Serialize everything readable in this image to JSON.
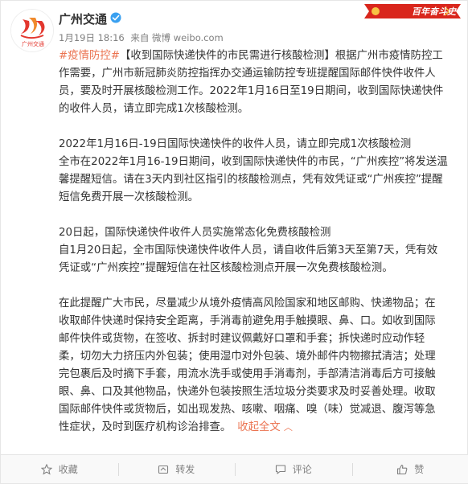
{
  "header": {
    "user_name": "广州交通",
    "time": "1月19日 18:16",
    "source": "来自 微博 weibo.com",
    "banner_text": "百年奋斗史"
  },
  "post": {
    "intro_hashtag": "#疫情防控#",
    "intro_lines": [
      "【收到国际快递快件的市民需进行核酸检测】根据广州市疫情防控工",
      "作需要，广州市新冠肺炎防控指挥办交通运输防控专班提醒国际邮件快件收件人",
      "员，要及时开展核酸检测工作。2022年1月16日至19日期间，收到国际快递快件",
      "的收件人员，请立即完成1次核酸检测。"
    ],
    "section1": [
      "2022年1月16日-19日国际快递快件的收件人员，请立即完成1次核酸检测",
      "全市在2022年1月16-19日期间，收到国际快递快件的市民，“广州疾控”将发送温",
      "馨提醒短信。请在3天内到社区指引的核酸检测点，凭有效凭证或“广州疾控”提醒",
      "短信免费开展一次核酸检测。"
    ],
    "section2": [
      "20日起，国际快递快件收件人员实施常态化免费核酸检测",
      "自1月20日起，全市国际快递快件收件人员，请自收件后第3天至第7天，凭有效",
      "凭证或“广州疾控”提醒短信在社区核酸检测点开展一次免费核酸检测。"
    ],
    "section3": [
      "在此提醒广大市民，尽量减少从境外疫情高风险国家和地区邮购、快递物品；在",
      "收取邮件快递时保持安全距离，手消毒前避免用手触摸眼、鼻、口。如收到国际",
      "邮件快件或货物，在签收、拆封时建议佩戴好口罩和手套；拆快递时应动作轻",
      "柔，切勿大力挤压内外包装；使用湿巾对外包装、境外邮件内物擦拭清洁；处理",
      "完包裹后及时摘下手套，用流水洗手或使用手消毒剂，手部清洁消毒后方可接触",
      "眼、鼻、口及其他物品，快递外包装按照生活垃圾分类要求及时妥善处理。收取",
      "国际邮件快件或货物后，如出现发热、咳嗽、咽痛、嗅（味）觉减退、腹泻等急",
      "性症状，及时到医疗机构诊治排查。"
    ],
    "collapse_label": "收起全文"
  },
  "toolbar": {
    "favorite_label": "收藏",
    "repost_label": "转发",
    "comment_label": "评论",
    "like_label": "赞"
  },
  "colors": {
    "link": "#eb7350",
    "banner": "#d9261c",
    "muted": "#808080"
  },
  "icons": [
    "avatar-logo",
    "verified-icon",
    "chevron-up-icon",
    "star-icon",
    "repost-icon",
    "comment-icon",
    "thumbs-up-icon"
  ]
}
